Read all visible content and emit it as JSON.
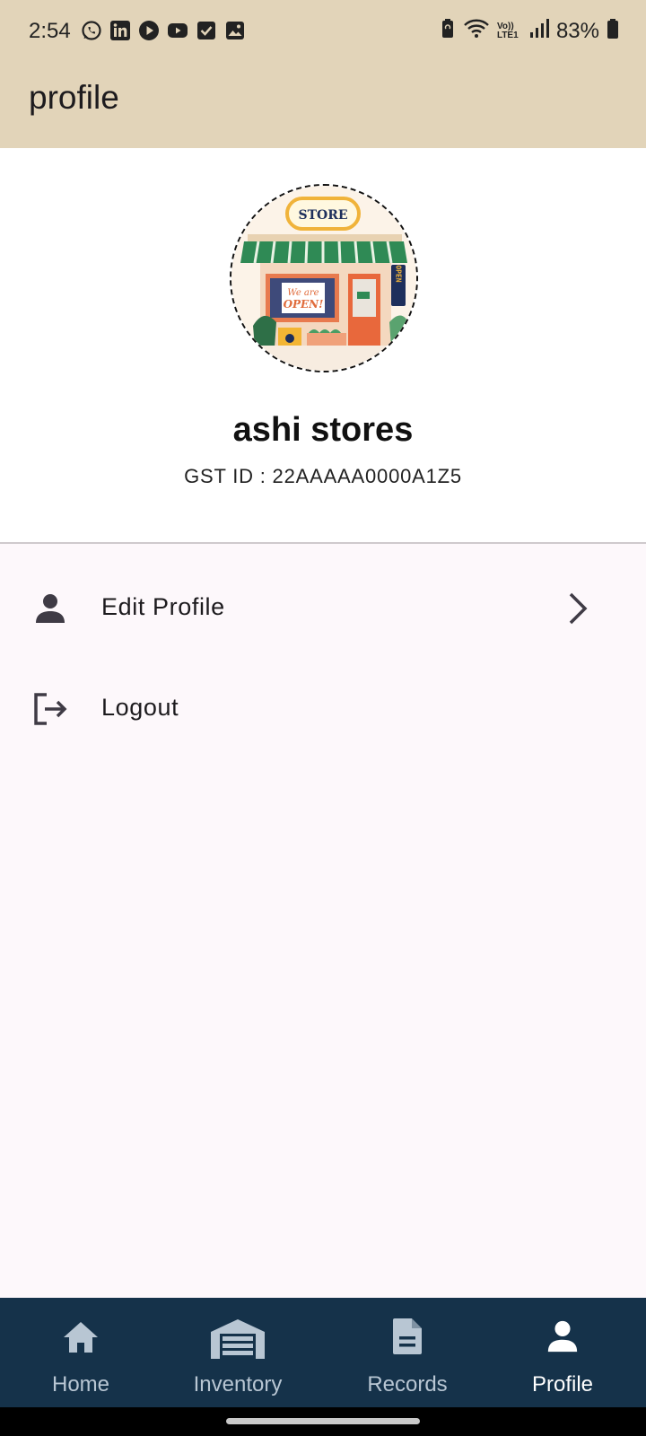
{
  "status_bar": {
    "time": "2:54",
    "battery_percent": "83%",
    "notification_icons": [
      "whatsapp-icon",
      "linkedin-icon",
      "play-icon",
      "youtube-icon",
      "checkbox-icon",
      "gallery-icon"
    ],
    "network_label": "Vo)) LTE1"
  },
  "app_bar": {
    "title": "profile"
  },
  "profile": {
    "store_name": "ashi stores",
    "gst_id": "GST ID : 22AAAAA0000A1Z5",
    "avatar": {
      "sign_text": "STORE",
      "window_text_1": "We are",
      "window_text_2": "OPEN!",
      "side_sign": "OPEN"
    }
  },
  "menu": {
    "edit_profile": "Edit Profile",
    "logout": "Logout"
  },
  "bottom_nav": {
    "items": [
      {
        "label": "Home",
        "icon": "home-icon"
      },
      {
        "label": "Inventory",
        "icon": "warehouse-icon"
      },
      {
        "label": "Records",
        "icon": "document-icon"
      },
      {
        "label": "Profile",
        "icon": "person-icon"
      }
    ],
    "active": "Profile"
  },
  "colors": {
    "app_bar": "#e2d4b9",
    "bottom_nav": "#15324a",
    "active_nav": "#ffffff",
    "inactive_nav": "#b8c6d3"
  }
}
